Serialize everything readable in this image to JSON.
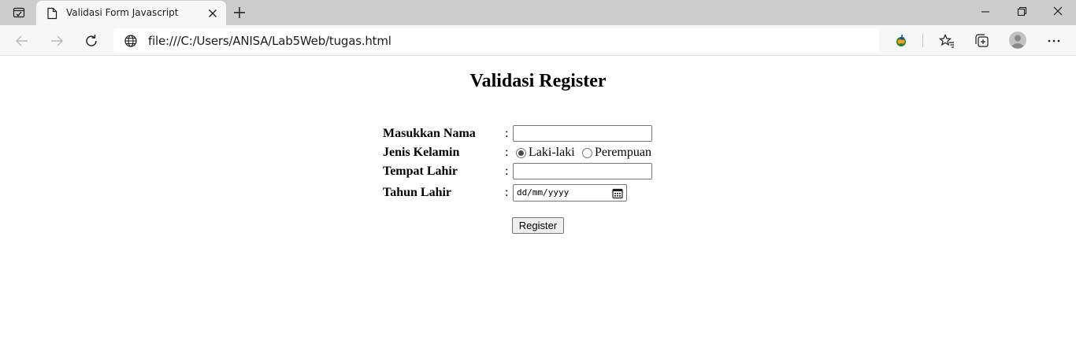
{
  "browser": {
    "tab_title": "Validasi Form Javascript",
    "address": "file:///C:/Users/ANISA/Lab5Web/tugas.html"
  },
  "page": {
    "title": "Validasi Register",
    "colon": ":",
    "form": {
      "nama_label": "Masukkan Nama",
      "nama_value": "",
      "jenis_kelamin_label": "Jenis Kelamin",
      "gender_options": [
        "Laki-laki",
        "Perempuan"
      ],
      "gender_selected": "Laki-laki",
      "tempat_lahir_label": "Tempat Lahir",
      "tempat_lahir_value": "",
      "tahun_lahir_label": "Tahun Lahir",
      "tahun_lahir_placeholder": "dd/mm/yyyy",
      "register_label": "Register"
    }
  },
  "colors": {
    "tabbar_bg": "#cdcdcd",
    "toolbar_bg": "#f7f7f7",
    "page_bg": "#ffffff"
  },
  "icons": {
    "tab_actions": "tab-actions-icon",
    "page": "page-icon",
    "close": "close-icon",
    "new_tab": "plus-icon",
    "back": "back-arrow-icon",
    "forward": "forward-arrow-icon",
    "refresh": "refresh-icon",
    "site_info": "globe-icon",
    "extension": "extension-icon",
    "favorites": "favorites-icon",
    "collections": "collections-icon",
    "profile": "profile-icon",
    "more": "more-icon",
    "calendar": "calendar-icon"
  }
}
